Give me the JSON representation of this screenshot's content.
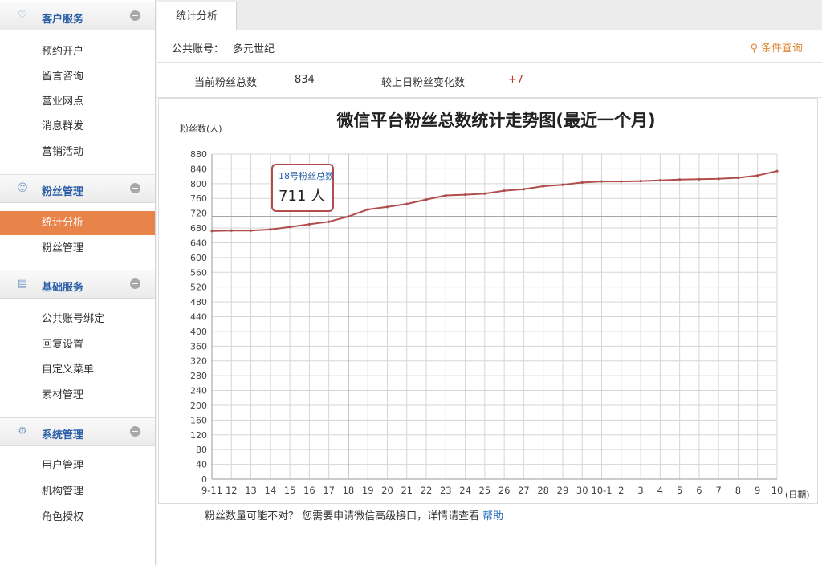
{
  "sidebar": {
    "sections": [
      {
        "title": "客户服务",
        "icon": "heart-icon",
        "items": [
          "预约开户",
          "留言咨询",
          "营业网点",
          "消息群发",
          "营销活动"
        ]
      },
      {
        "title": "粉丝管理",
        "icon": "users-icon",
        "items": [
          "统计分析",
          "粉丝管理"
        ]
      },
      {
        "title": "基础服务",
        "icon": "document-icon",
        "items": [
          "公共账号绑定",
          "回复设置",
          "自定义菜单",
          "素材管理"
        ]
      },
      {
        "title": "系统管理",
        "icon": "gear-icon",
        "items": [
          "用户管理",
          "机构管理",
          "角色授权"
        ]
      }
    ],
    "active_item": "统计分析"
  },
  "tabs": [
    {
      "label": "统计分析",
      "active": true
    }
  ],
  "account": {
    "label": "公共账号：",
    "name": "多元世纪"
  },
  "query_button": "条件查询",
  "stats": {
    "total_label": "当前粉丝总数",
    "total_value": "834",
    "change_label": "较上日粉丝变化数",
    "change_value": "+7"
  },
  "chart_data": {
    "type": "line",
    "title": "微信平台粉丝总数统计走势图(最近一个月)",
    "ylabel": "粉丝数(人)",
    "xlabel": "(日期)",
    "ylim": [
      0,
      880
    ],
    "y_ticks": [
      0,
      40,
      80,
      120,
      160,
      200,
      240,
      280,
      320,
      360,
      400,
      440,
      480,
      520,
      560,
      600,
      640,
      680,
      720,
      760,
      800,
      840,
      880
    ],
    "categories": [
      "9-11",
      "12",
      "13",
      "14",
      "15",
      "16",
      "17",
      "18",
      "19",
      "20",
      "21",
      "22",
      "23",
      "24",
      "25",
      "26",
      "27",
      "28",
      "29",
      "30",
      "10-1",
      "2",
      "3",
      "4",
      "5",
      "6",
      "7",
      "8",
      "9",
      "10"
    ],
    "series": [
      {
        "values": [
          672,
          673,
          673,
          676,
          683,
          690,
          697,
          711,
          730,
          737,
          745,
          757,
          768,
          770,
          773,
          781,
          785,
          793,
          797,
          803,
          806,
          806,
          807,
          809,
          811,
          812,
          813,
          816,
          822,
          834
        ]
      }
    ],
    "grid": true,
    "line_color": "#b14d4d",
    "tooltip": {
      "date_label": "18号粉丝总数",
      "value": "711 人",
      "category": "18",
      "value_num": 711
    }
  },
  "footer": {
    "note": "粉丝数量可能不对？ 您需要申请微信高级接口，详情请查看",
    "help": "帮助"
  }
}
